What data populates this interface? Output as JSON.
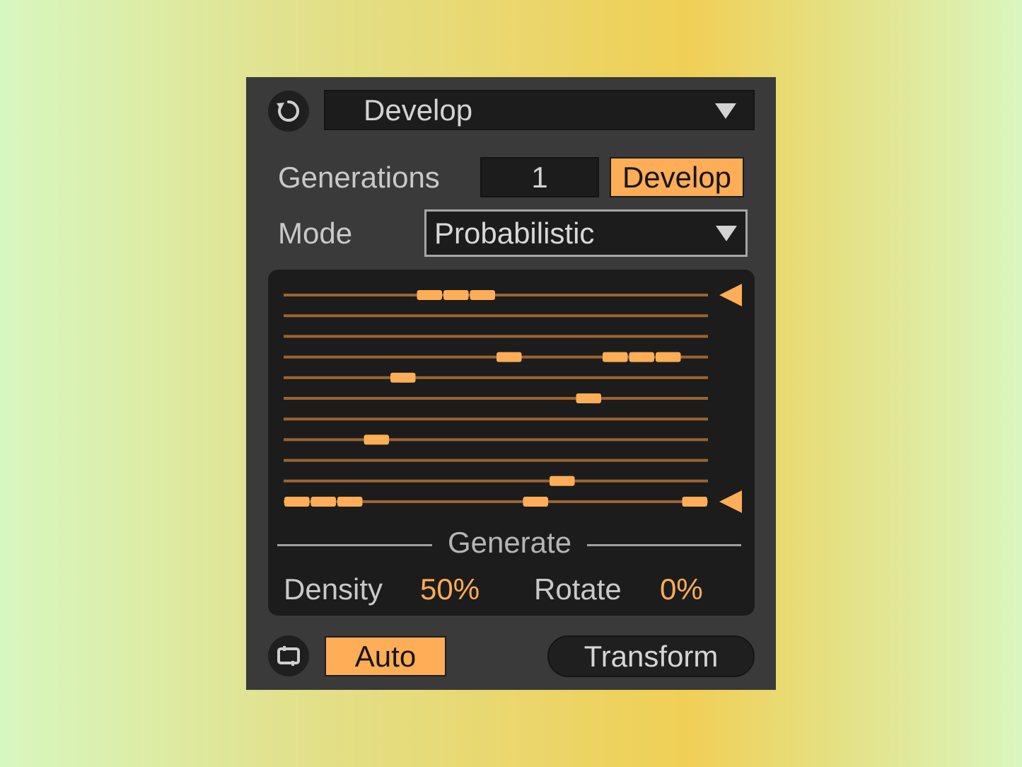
{
  "header": {
    "reset_icon": "reset-icon",
    "preset_select_value": "Develop"
  },
  "generations": {
    "label": "Generations",
    "value": "1",
    "develop_button_label": "Develop"
  },
  "mode": {
    "label": "Mode",
    "value": "Probabilistic"
  },
  "sequence_grid": {
    "rows": 11,
    "steps": 16,
    "colors": {
      "line": "#9c6430",
      "note": "#ffad56",
      "marker": "#ffad56"
    },
    "notes": [
      {
        "row": 0,
        "step": 5
      },
      {
        "row": 0,
        "step": 6
      },
      {
        "row": 0,
        "step": 7
      },
      {
        "row": 3,
        "step": 8
      },
      {
        "row": 3,
        "step": 12
      },
      {
        "row": 3,
        "step": 13
      },
      {
        "row": 3,
        "step": 14
      },
      {
        "row": 4,
        "step": 4
      },
      {
        "row": 5,
        "step": 11
      },
      {
        "row": 7,
        "step": 3
      },
      {
        "row": 9,
        "step": 10
      },
      {
        "row": 10,
        "step": 0
      },
      {
        "row": 10,
        "step": 1
      },
      {
        "row": 10,
        "step": 2
      },
      {
        "row": 10,
        "step": 9
      },
      {
        "row": 10,
        "step": 15
      }
    ],
    "range_markers": [
      {
        "row": 0
      },
      {
        "row": 10
      }
    ]
  },
  "generate": {
    "section_label": "Generate",
    "density_label": "Density",
    "density_value": "50%",
    "rotate_label": "Rotate",
    "rotate_value": "0%"
  },
  "footer": {
    "loop_icon": "loop-icon",
    "auto_label": "Auto",
    "transform_label": "Transform"
  },
  "colors": {
    "accent": "#ffad56",
    "panel": "#3a3a3a",
    "field": "#1c1c1c"
  }
}
